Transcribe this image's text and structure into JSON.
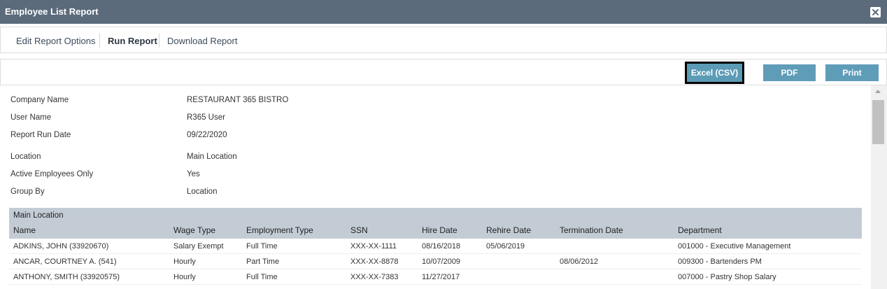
{
  "window": {
    "title": "Employee List Report"
  },
  "tabs": [
    {
      "label": "Edit Report Options",
      "active": false
    },
    {
      "label": "Run Report",
      "active": true
    },
    {
      "label": "Download Report",
      "active": false
    }
  ],
  "toolbar": {
    "csv_label": "Excel (CSV)",
    "pdf_label": "PDF",
    "print_label": "Print"
  },
  "report_meta": [
    {
      "label": "Company Name",
      "value": "RESTAURANT 365 BISTRO"
    },
    {
      "label": "User Name",
      "value": "R365 User"
    },
    {
      "label": "Report Run Date",
      "value": "09/22/2020"
    },
    {
      "label": "Location",
      "value": "Main Location"
    },
    {
      "label": "Active Employees Only",
      "value": "Yes"
    },
    {
      "label": "Group By",
      "value": "Location"
    }
  ],
  "table": {
    "group": "Main Location",
    "columns": [
      "Name",
      "Wage Type",
      "Employment Type",
      "SSN",
      "Hire Date",
      "Rehire Date",
      "Termination Date",
      "Department"
    ],
    "rows": [
      [
        "ADKINS, JOHN (33920670)",
        "Salary Exempt",
        "Full Time",
        "XXX-XX-1111",
        "08/16/2018",
        "05/06/2019",
        "",
        "001000 - Executive Management"
      ],
      [
        "ANCAR, COURTNEY A. (541)",
        "Hourly",
        "Part Time",
        "XXX-XX-8878",
        "10/07/2009",
        "",
        "08/06/2012",
        "009300 - Bartenders PM"
      ],
      [
        "ANTHONY, SMITH (33920575)",
        "Hourly",
        "Full Time",
        "XXX-XX-7383",
        "11/27/2017",
        "",
        "",
        "007000 - Pastry Shop Salary"
      ]
    ]
  },
  "colors": {
    "titlebar": "#5b6b7b",
    "button": "#5f9cb8",
    "table_header": "#c3ccd5"
  },
  "icons": {
    "close": "close-icon",
    "scroll_up": "chevron-up-icon"
  }
}
